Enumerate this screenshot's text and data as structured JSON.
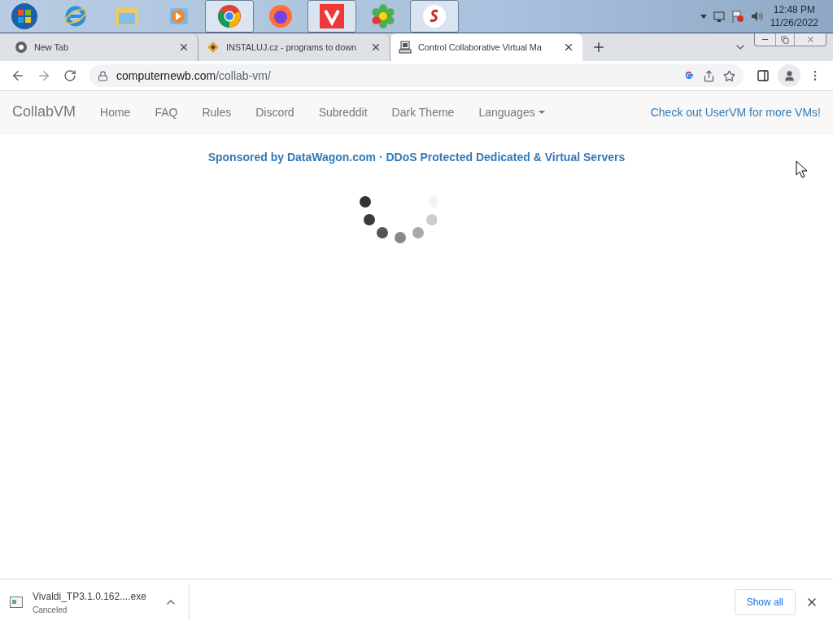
{
  "taskbar": {
    "apps": [
      {
        "running": false
      },
      {
        "running": false
      },
      {
        "running": false
      },
      {
        "running": true
      },
      {
        "running": false
      },
      {
        "running": true
      },
      {
        "running": false
      },
      {
        "running": true
      }
    ],
    "clock": {
      "time": "12:48 PM",
      "date": "11/26/2022"
    }
  },
  "tabs": [
    {
      "title": "New Tab",
      "selected": false
    },
    {
      "title": "INSTALUJ.cz - programs to down",
      "selected": false
    },
    {
      "title": "Control Collaborative Virtual Ma",
      "selected": true
    }
  ],
  "address": {
    "url_host": "computernewb.com",
    "url_path": "/collab-vm/"
  },
  "navbar": {
    "brand": "CollabVM",
    "items": [
      "Home",
      "FAQ",
      "Rules",
      "Discord",
      "Subreddit",
      "Dark Theme"
    ],
    "dropdown": "Languages",
    "link": "Check out UserVM for more VMs!"
  },
  "sponsor": "Sponsored by DataWagon.com · DDoS Protected Dedicated & Virtual Servers",
  "download": {
    "filename": "Vivaldi_TP3.1.0.162....exe",
    "status": "Canceled",
    "show_all": "Show all"
  }
}
